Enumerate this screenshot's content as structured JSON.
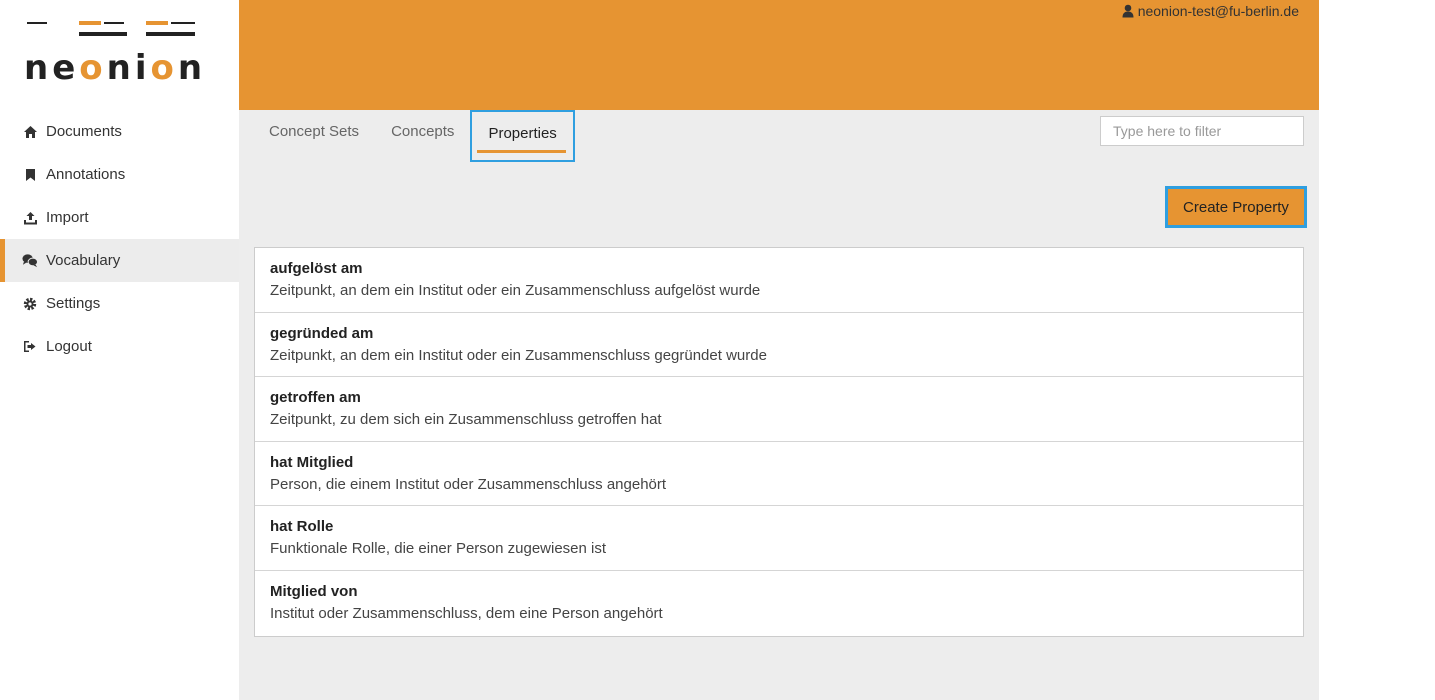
{
  "logo": {
    "text_pre": "ne",
    "text_o1": "o",
    "text_mid": "ni",
    "text_o2": "o",
    "text_post": "n"
  },
  "header": {
    "user_email": "neonion-test@fu-berlin.de"
  },
  "sidebar": {
    "items": [
      {
        "label": "Documents",
        "icon": "home-icon"
      },
      {
        "label": "Annotations",
        "icon": "bookmark-icon"
      },
      {
        "label": "Import",
        "icon": "upload-icon"
      },
      {
        "label": "Vocabulary",
        "icon": "chat-icon",
        "active": true
      },
      {
        "label": "Settings",
        "icon": "gear-icon"
      },
      {
        "label": "Logout",
        "icon": "sign-out-icon"
      }
    ]
  },
  "tabs": [
    {
      "label": "Concept Sets"
    },
    {
      "label": "Concepts"
    },
    {
      "label": "Properties",
      "active": true
    }
  ],
  "filter": {
    "placeholder": "Type here to filter",
    "value": ""
  },
  "toolbar": {
    "create_label": "Create Property"
  },
  "properties": [
    {
      "name": "aufgelöst am",
      "description": "Zeitpunkt, an dem ein Institut oder ein Zusammenschluss aufgelöst wurde"
    },
    {
      "name": "gegründed am",
      "description": "Zeitpunkt, an dem ein Institut oder ein Zusammenschluss gegründet wurde"
    },
    {
      "name": "getroffen am",
      "description": "Zeitpunkt, zu dem sich ein Zusammenschluss getroffen hat"
    },
    {
      "name": "hat Mitglied",
      "description": "Person, die einem Institut oder Zusammenschluss angehört"
    },
    {
      "name": "hat Rolle",
      "description": "Funktionale Rolle, die einer Person zugewiesen ist"
    },
    {
      "name": "Mitglied von",
      "description": "Institut oder Zusammenschluss, dem eine Person angehört"
    }
  ],
  "colors": {
    "accent": "#e69432",
    "focus": "#2f9fe0",
    "background": "#ededed"
  }
}
